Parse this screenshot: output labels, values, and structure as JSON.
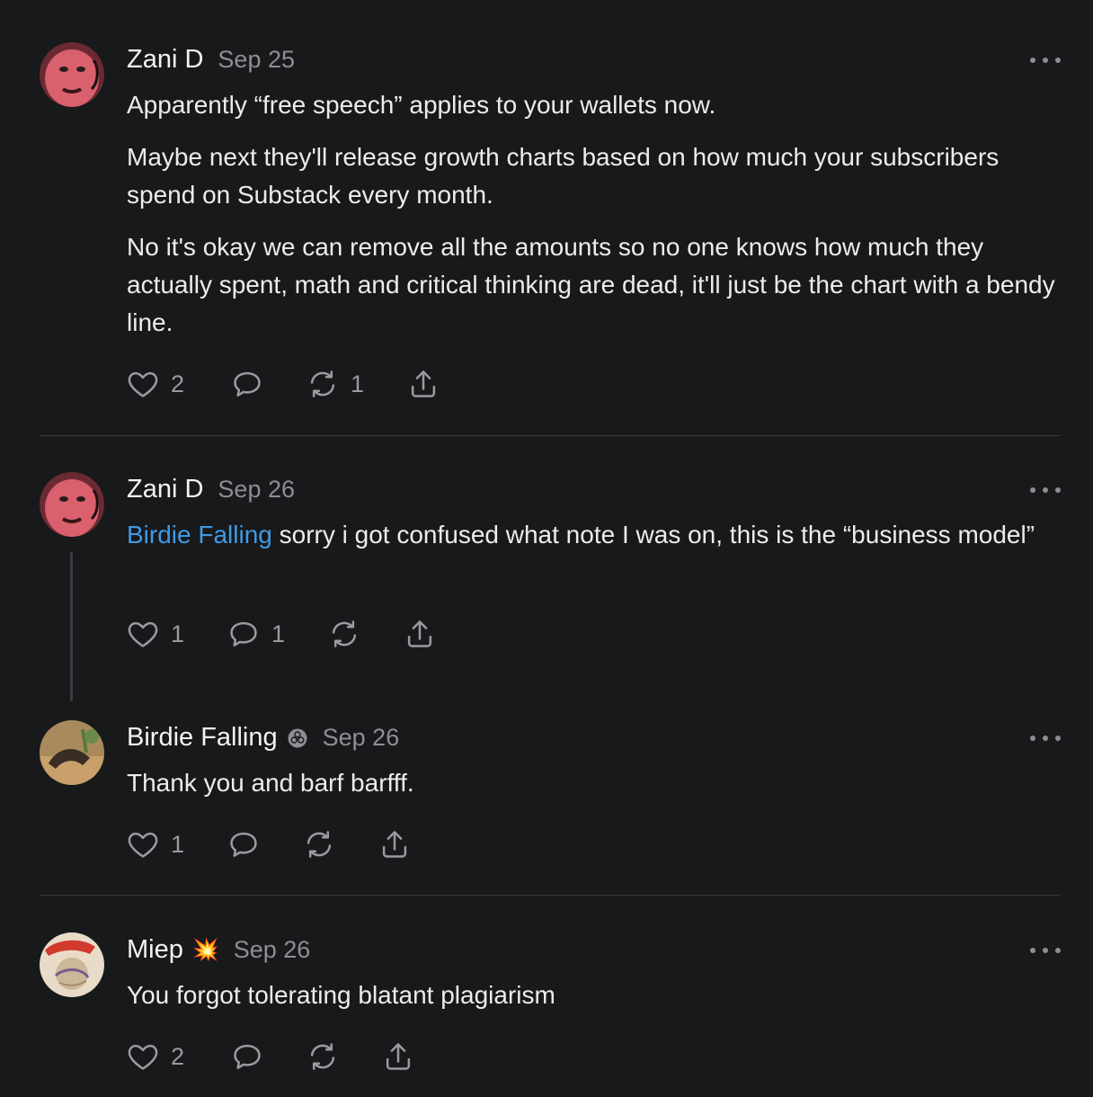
{
  "notes": [
    {
      "author": "Zani D",
      "date": "Sep 25",
      "paragraphs": [
        "Apparently “free speech” applies to your wallets now.",
        "Maybe next they'll release growth charts based on how much your subscribers spend on Substack every month.",
        "No it's okay we can remove all the amounts so no one knows how much they actually spent, math and critical thinking are dead, it'll just be the chart with a bendy line."
      ],
      "likes": "2",
      "comments": "",
      "restacks": "1"
    },
    {
      "author": "Zani D",
      "date": "Sep 26",
      "mention": "Birdie Falling",
      "text": " sorry i got confused what note I was on, this is the “business model”",
      "likes": "1",
      "comments": "1",
      "restacks": ""
    },
    {
      "author": "Birdie Falling",
      "date": "Sep 26",
      "text": "Thank you and barf barfff.",
      "likes": "1",
      "comments": "",
      "restacks": ""
    },
    {
      "author": "Miep",
      "badge": "💥",
      "date": "Sep 26",
      "text": "You forgot tolerating blatant plagiarism",
      "likes": "2",
      "comments": "",
      "restacks": ""
    }
  ],
  "icons": {
    "like": "heart-icon",
    "comment": "comment-icon",
    "restack": "restack-icon",
    "share": "share-icon",
    "more": "more-options-icon",
    "verified": "subscriber-badge-icon"
  },
  "colors": {
    "background": "#18191b",
    "text": "#ececec",
    "muted": "#8e8e93",
    "mention": "#3f9ae4",
    "divider": "#3a3a3d"
  }
}
